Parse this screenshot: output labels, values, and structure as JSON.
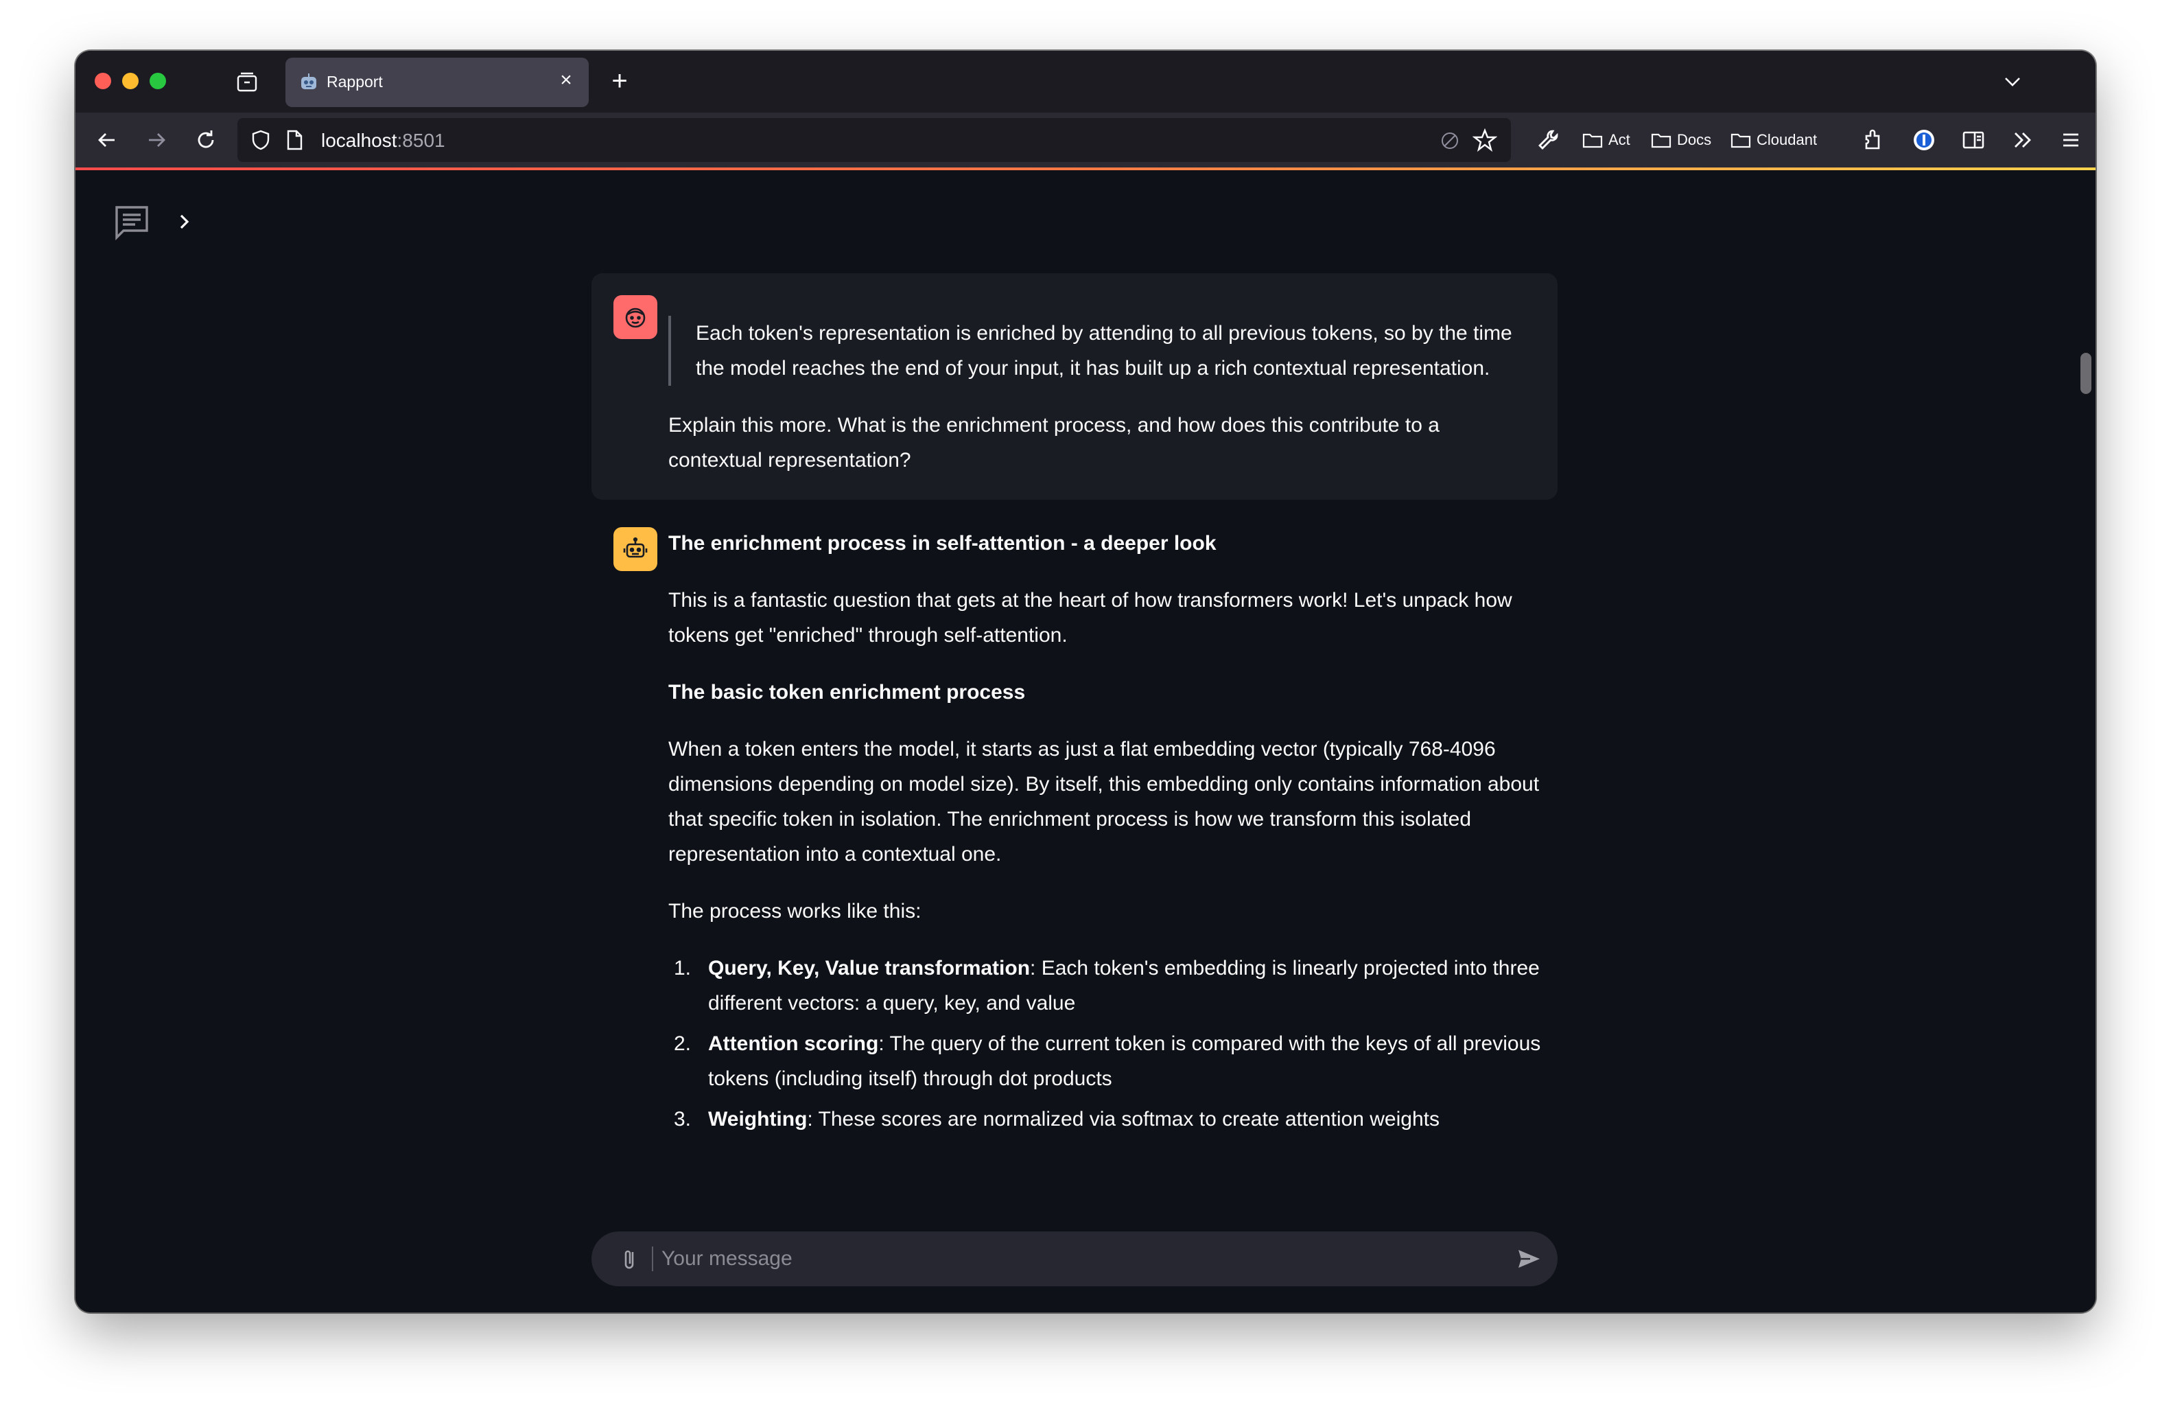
{
  "browser": {
    "tab": {
      "title": "Rapport",
      "favicon": "robot-icon"
    },
    "url": {
      "host": "localhost",
      "port": ":8501"
    },
    "bookmarks": [
      {
        "label": "Act",
        "icon": "folder-icon"
      },
      {
        "label": "Docs",
        "icon": "folder-icon"
      },
      {
        "label": "Cloudant",
        "icon": "folder-icon"
      }
    ]
  },
  "chat": {
    "user_message": {
      "quote": "Each token's representation is enriched by attending to all previous tokens, so by the time the model reaches the end of your input, it has built up a rich contextual representation.",
      "question": "Explain this more. What is the enrichment process, and how does this contribute to a contextual representation?"
    },
    "assistant_message": {
      "title": "The enrichment process in self-attention - a deeper look",
      "intro": "This is a fantastic question that gets at the heart of how transformers work! Let's unpack how tokens get \"enriched\" through self-attention.",
      "section_heading": "The basic token enrichment process",
      "paragraph": "When a token enters the model, it starts as just a flat embedding vector (typically 768-4096 dimensions depending on model size). By itself, this embedding only contains information about that specific token in isolation. The enrichment process is how we transform this isolated representation into a contextual one.",
      "list_intro": "The process works like this:",
      "steps": [
        {
          "num": "1.",
          "term": "Query, Key, Value transformation",
          "text": ": Each token's embedding is linearly projected into three different vectors: a query, key, and value"
        },
        {
          "num": "2.",
          "term": "Attention scoring",
          "text": ": The query of the current token is compared with the keys of all previous tokens (including itself) through dot products"
        },
        {
          "num": "3.",
          "term": "Weighting",
          "text": ": These scores are normalized via softmax to create attention weights"
        }
      ]
    },
    "input": {
      "placeholder": "Your message",
      "value": ""
    }
  },
  "colors": {
    "app_bg": "#0e1117",
    "user_bubble": "#1a1c24",
    "user_avatar": "#ff6b6b",
    "bot_avatar": "#ffbd45",
    "accent": "#ff4b4b"
  }
}
